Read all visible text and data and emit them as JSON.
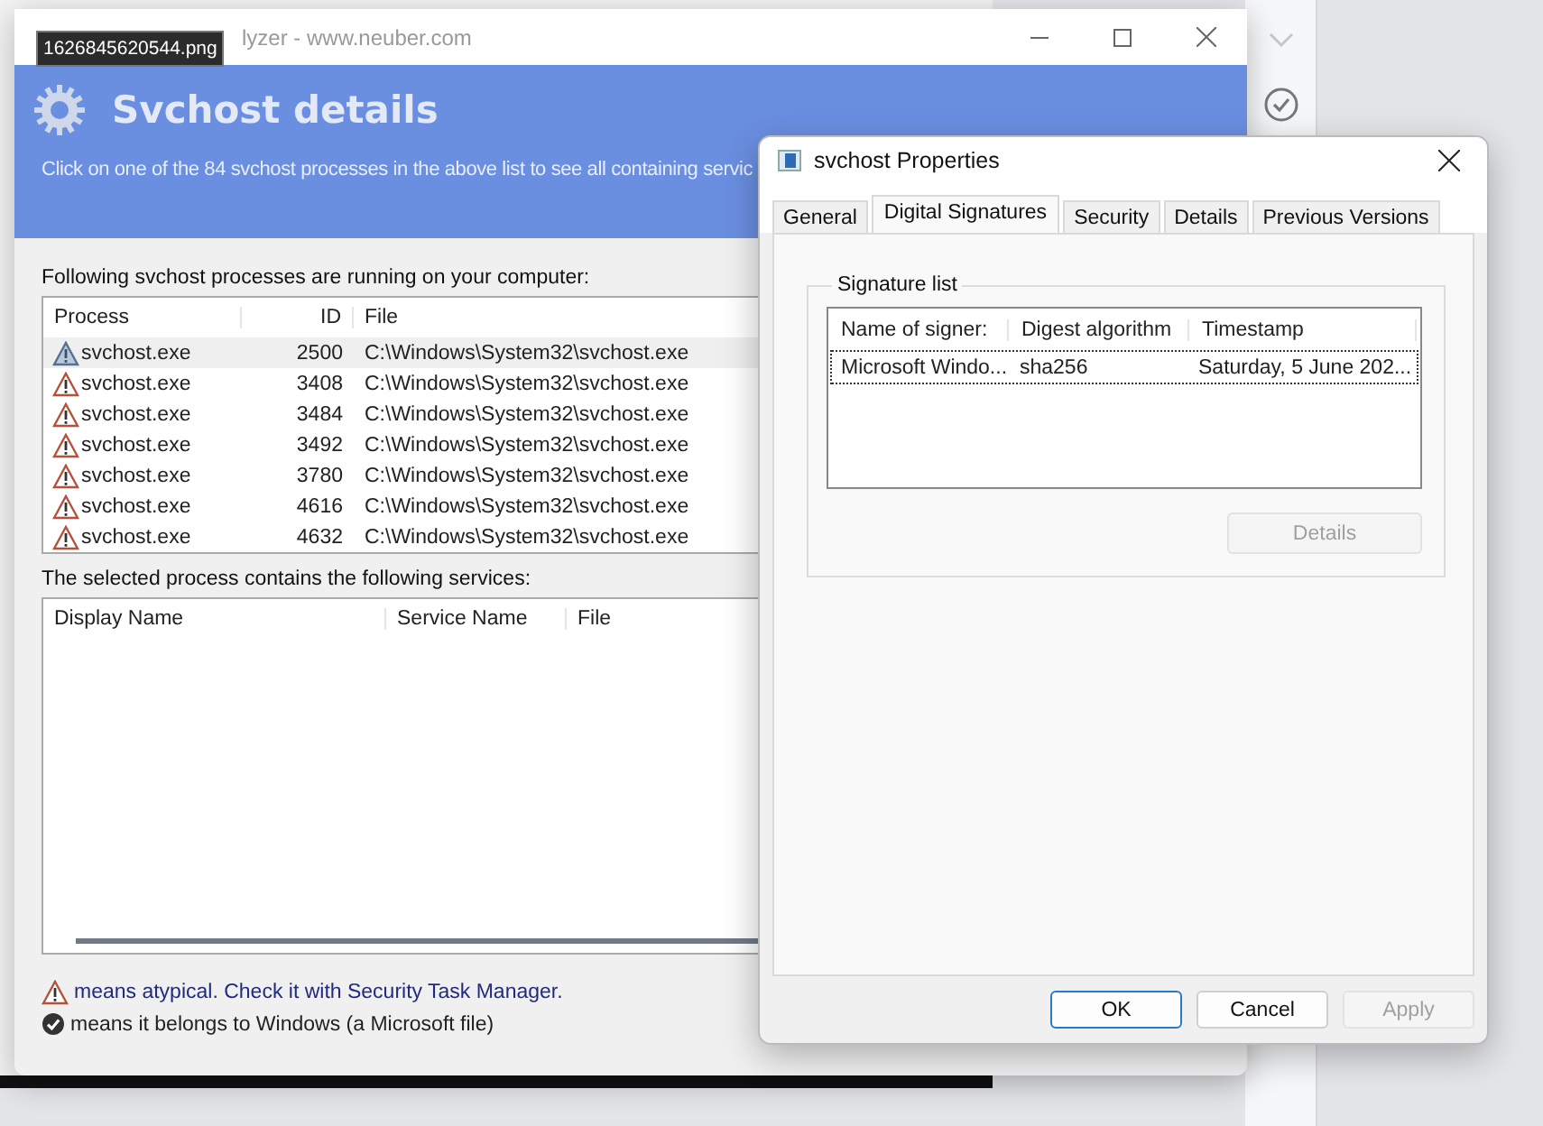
{
  "main_window": {
    "title": "lyzer - www.neuber.com",
    "tooltip": "1626845620544.png",
    "header": {
      "title": "Svchost details",
      "subtitle": "Click on one of the 84 svchost processes in the above list to see all containing servic"
    },
    "processes_label": "Following svchost processes are running on your computer:",
    "process_table": {
      "columns": [
        "Process",
        "ID",
        "File"
      ],
      "rows": [
        {
          "process": "svchost.exe",
          "id": "2500",
          "file": "C:\\Windows\\System32\\svchost.exe",
          "selected": true
        },
        {
          "process": "svchost.exe",
          "id": "3408",
          "file": "C:\\Windows\\System32\\svchost.exe",
          "selected": false
        },
        {
          "process": "svchost.exe",
          "id": "3484",
          "file": "C:\\Windows\\System32\\svchost.exe",
          "selected": false
        },
        {
          "process": "svchost.exe",
          "id": "3492",
          "file": "C:\\Windows\\System32\\svchost.exe",
          "selected": false
        },
        {
          "process": "svchost.exe",
          "id": "3780",
          "file": "C:\\Windows\\System32\\svchost.exe",
          "selected": false
        },
        {
          "process": "svchost.exe",
          "id": "4616",
          "file": "C:\\Windows\\System32\\svchost.exe",
          "selected": false
        },
        {
          "process": "svchost.exe",
          "id": "4632",
          "file": "C:\\Windows\\System32\\svchost.exe",
          "selected": false
        }
      ]
    },
    "services_label": "The selected process contains the following services:",
    "services_table": {
      "columns": [
        "Display Name",
        "Service Name",
        "File"
      ]
    },
    "legend": [
      {
        "kind": "warning",
        "text": "means atypical. Check it with Security Task Manager."
      },
      {
        "kind": "check",
        "text": "means it belongs to Windows (a Microsoft file)"
      }
    ]
  },
  "properties_dialog": {
    "title": "svchost Properties",
    "tabs": [
      {
        "label": "General",
        "selected": false
      },
      {
        "label": "Digital Signatures",
        "selected": true
      },
      {
        "label": "Security",
        "selected": false
      },
      {
        "label": "Details",
        "selected": false
      },
      {
        "label": "Previous Versions",
        "selected": false
      }
    ],
    "group_title": "Signature list",
    "columns": [
      "Name of signer:",
      "Digest algorithm",
      "Timestamp"
    ],
    "rows": [
      {
        "signer": "Microsoft Windo...",
        "digest": "sha256",
        "timestamp": "Saturday, 5 June 202...",
        "focused": true
      }
    ],
    "details_button": {
      "label": "Details",
      "disabled": true
    },
    "buttons": [
      {
        "label": "OK",
        "default": true,
        "disabled": false
      },
      {
        "label": "Cancel",
        "default": false,
        "disabled": false
      },
      {
        "label": "Apply",
        "default": false,
        "disabled": true
      }
    ]
  }
}
